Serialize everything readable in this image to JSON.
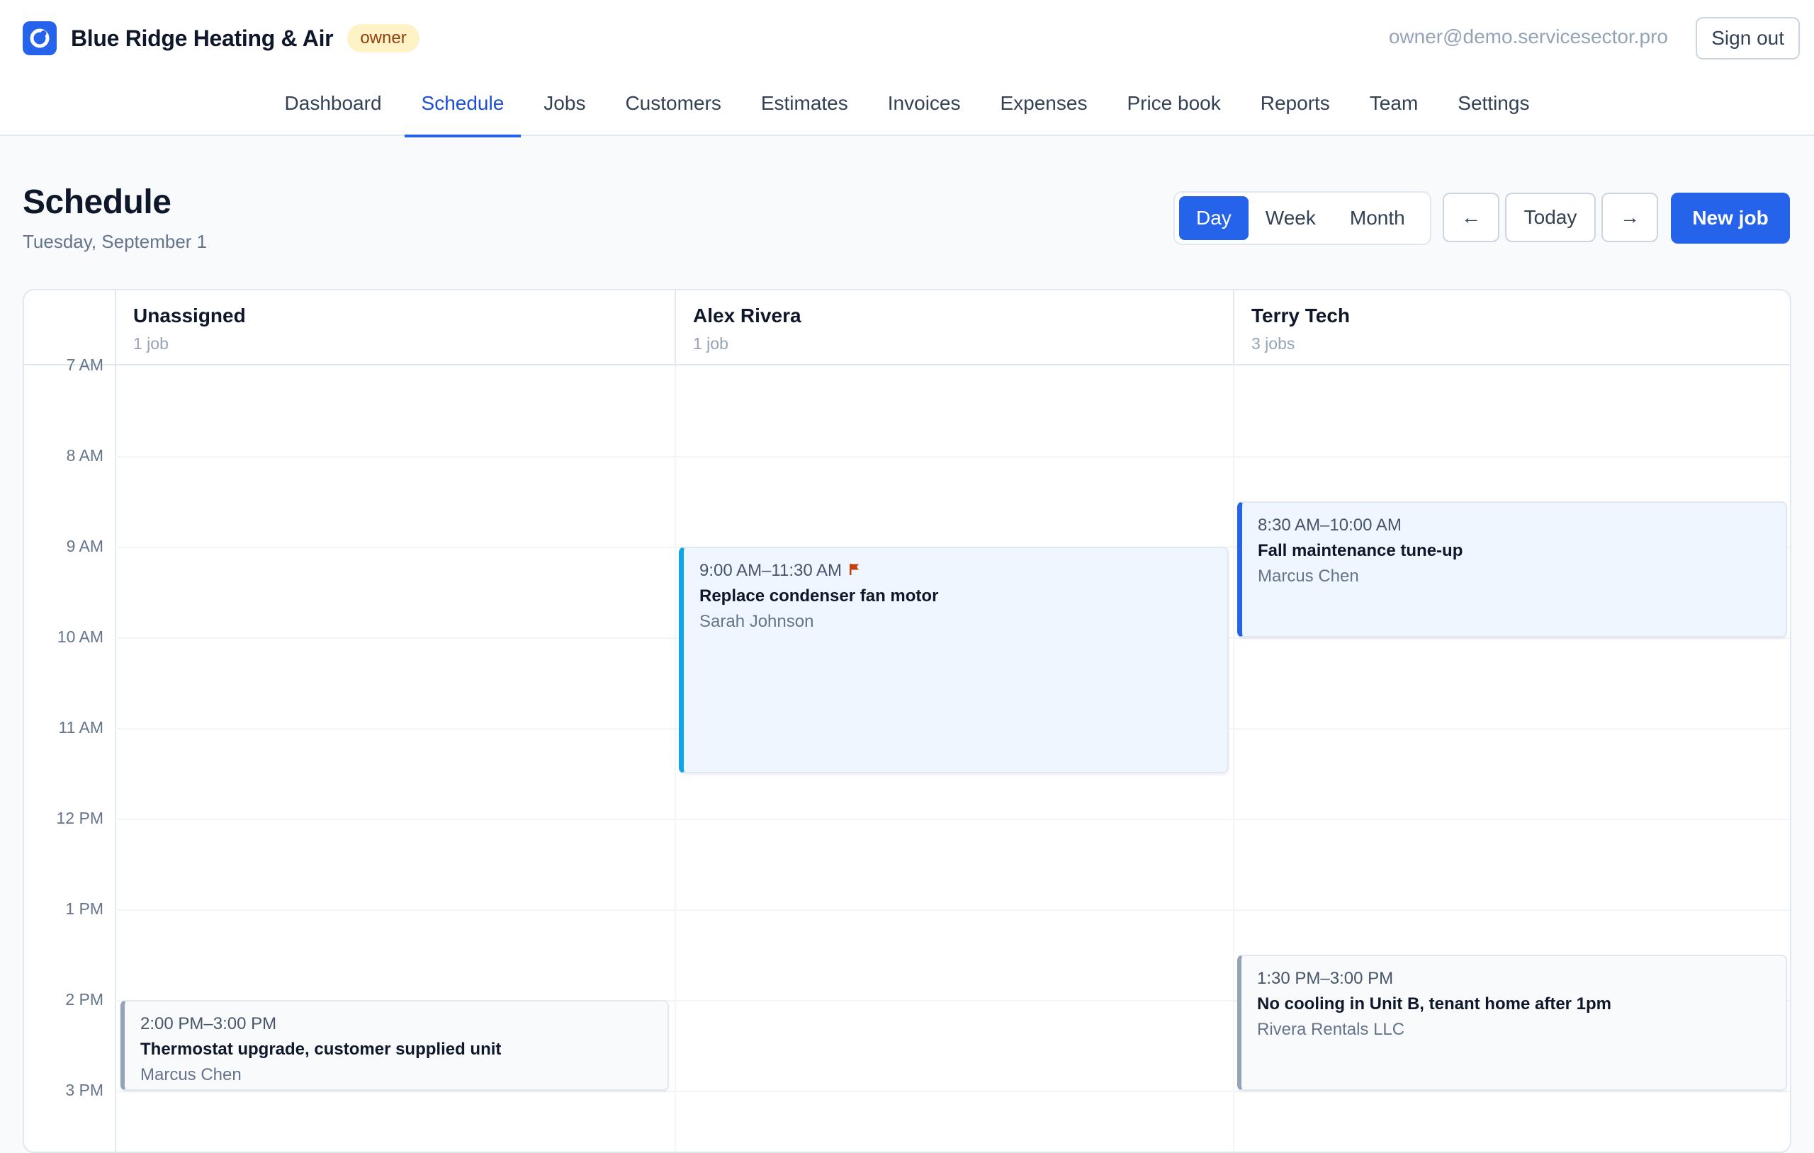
{
  "app": {
    "company": "Blue Ridge Heating & Air",
    "role": "owner",
    "user_email": "owner@demo.servicesector.pro",
    "sign_out_label": "Sign out"
  },
  "nav": {
    "active": "Schedule",
    "items": [
      {
        "label": "Dashboard"
      },
      {
        "label": "Schedule"
      },
      {
        "label": "Jobs"
      },
      {
        "label": "Customers"
      },
      {
        "label": "Estimates"
      },
      {
        "label": "Invoices"
      },
      {
        "label": "Expenses"
      },
      {
        "label": "Price book"
      },
      {
        "label": "Reports"
      },
      {
        "label": "Team"
      },
      {
        "label": "Settings"
      }
    ]
  },
  "page": {
    "title": "Schedule",
    "date": "Tuesday, September 1"
  },
  "toolbar": {
    "views": [
      "Day",
      "Week",
      "Month"
    ],
    "active_view": "Day",
    "prev_label": "←",
    "today_label": "Today",
    "next_label": "→",
    "new_job_label": "New job"
  },
  "calendar": {
    "hours": [
      "7 AM",
      "8 AM",
      "9 AM",
      "10 AM",
      "11 AM",
      "12 PM",
      "1 PM",
      "2 PM",
      "3 PM"
    ],
    "columns": [
      {
        "name": "Unassigned",
        "count": "1 job",
        "events": [
          {
            "time": "2:00 PM–3:00 PM",
            "title": "Thermostat upgrade, customer supplied unit",
            "customer": "Marcus Chen",
            "flag": false,
            "accent": "#94a3b8",
            "bg": "#f8fafc"
          }
        ]
      },
      {
        "name": "Alex Rivera",
        "count": "1 job",
        "events": [
          {
            "time": "9:00 AM–11:30 AM",
            "title": "Replace condenser fan motor",
            "customer": "Sarah Johnson",
            "flag": true,
            "accent": "#0ea5e9",
            "bg": "#eff6ff"
          }
        ]
      },
      {
        "name": "Terry Tech",
        "count": "3 jobs",
        "events": [
          {
            "time": "8:30 AM–10:00 AM",
            "title": "Fall maintenance tune-up",
            "customer": "Marcus Chen",
            "flag": false,
            "accent": "#2563eb",
            "bg": "#eff6ff"
          },
          {
            "time": "1:30 PM–3:00 PM",
            "title": "No cooling in Unit B, tenant home after 1pm",
            "customer": "Rivera Rentals LLC",
            "flag": false,
            "accent": "#94a3b8",
            "bg": "#f8fafc"
          }
        ]
      }
    ]
  },
  "colors": {
    "primary": "#2563eb",
    "flag": "#c2410c"
  },
  "icons": {
    "logo": "logo-icon",
    "flag": "flag-icon"
  }
}
